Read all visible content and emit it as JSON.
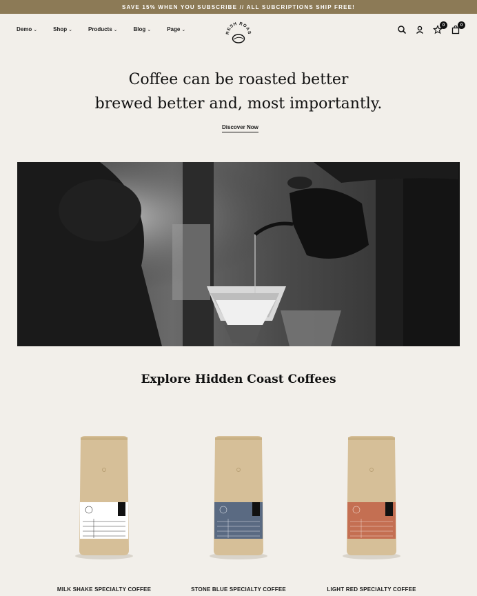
{
  "announcement": "SAVE 15% WHEN YOU SUBSCRIBE // ALL SUBCRIPTIONS SHIP FREE!",
  "nav": {
    "items": [
      {
        "label": "Demo"
      },
      {
        "label": "Shop"
      },
      {
        "label": "Products"
      },
      {
        "label": "Blog"
      },
      {
        "label": "Page"
      }
    ]
  },
  "logo": {
    "text": "FRESH ROAST"
  },
  "header_icons": {
    "search": "search-icon",
    "account": "user-icon",
    "wishlist": "star-icon",
    "wishlist_count": "0",
    "cart": "bag-icon",
    "cart_count": "0"
  },
  "hero": {
    "line1": "Coffee can be roasted better",
    "line2": "brewed better and, most importantly.",
    "cta": "Discover Now"
  },
  "section": {
    "title": "Explore Hidden Coast Coffees"
  },
  "products": [
    {
      "name": "MILK SHAKE SPECIALTY COFFEE",
      "label_color": "#ffffff"
    },
    {
      "name": "STONE BLUE SPECIALTY COFFEE",
      "label_color": "#5a6a82"
    },
    {
      "name": "LIGHT RED SPECIALTY COFFEE",
      "label_color": "#c46f52"
    }
  ],
  "colors": {
    "announcement_bg": "#8c7a56",
    "page_bg": "#f2efea",
    "bag_kraft": "#d6bf98"
  }
}
